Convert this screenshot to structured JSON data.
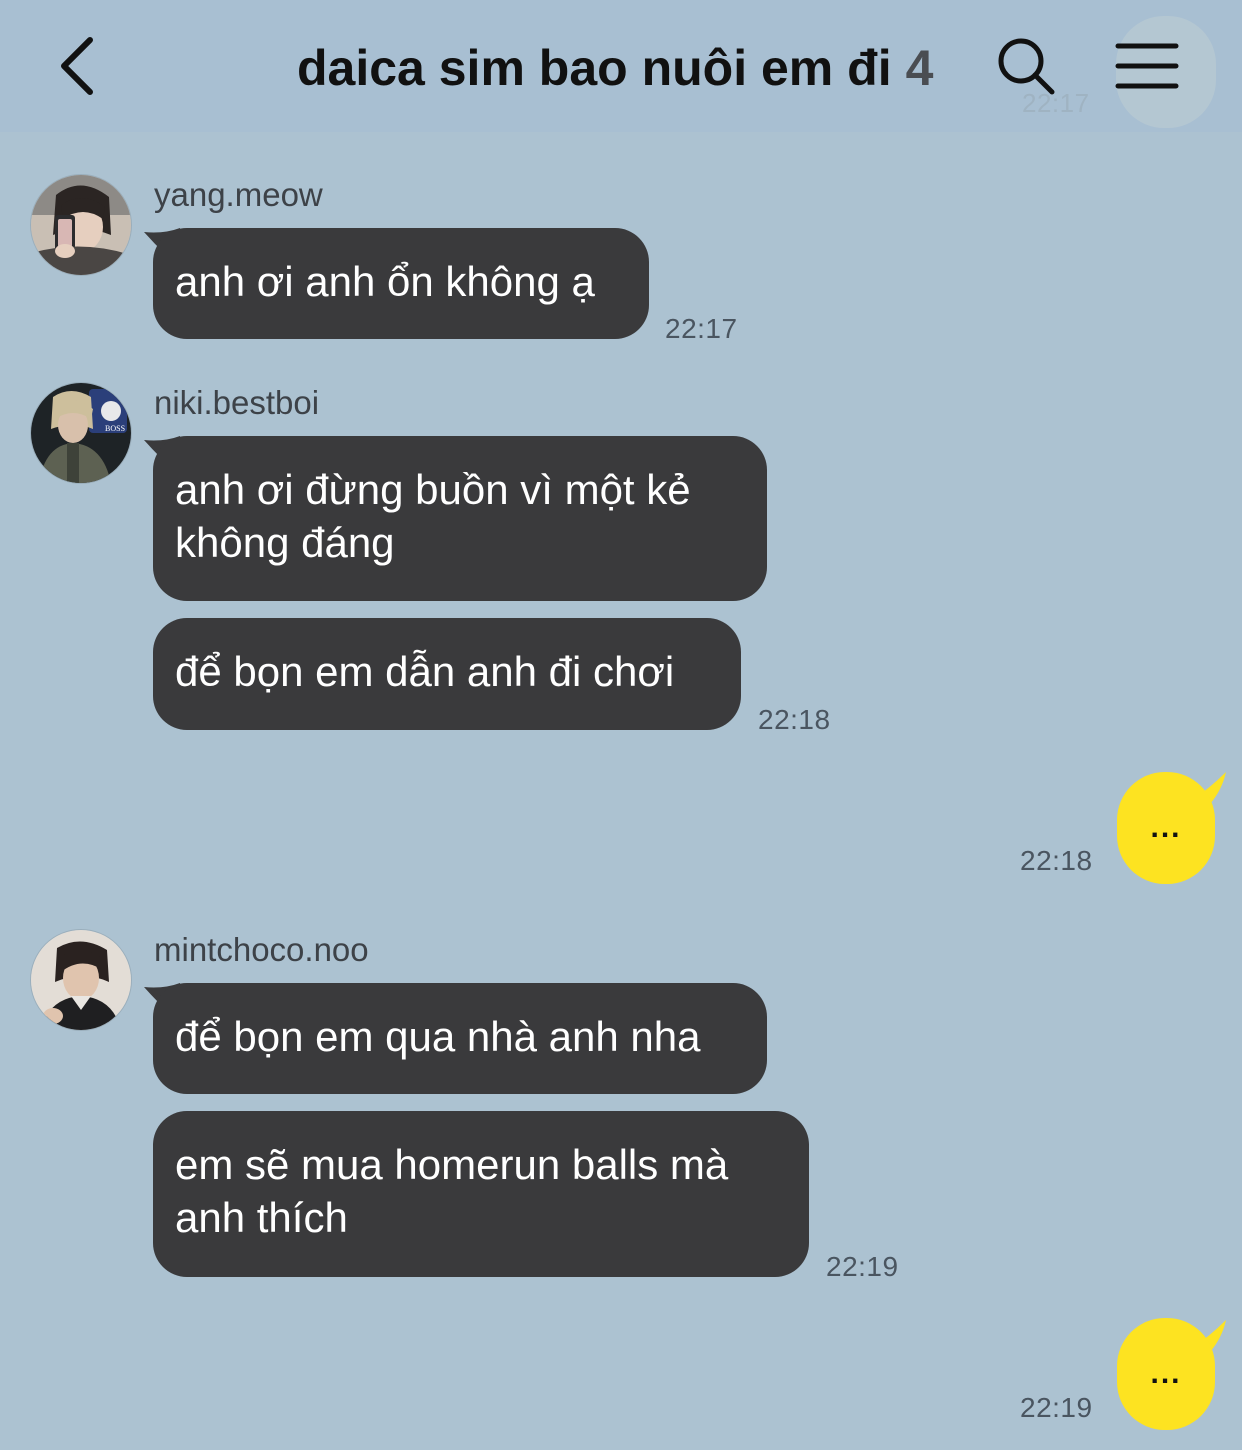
{
  "header": {
    "title": "daica sim bao nuôi em đi",
    "member_count": "4",
    "ghost_time": "22:17"
  },
  "messages": {
    "m1": {
      "sender": "yang.meow",
      "lines": [
        "anh ơi anh ổn không ạ"
      ],
      "time": "22:17"
    },
    "m2": {
      "sender": "niki.bestboi",
      "bubble1_lines": [
        "anh ơi đừng buồn vì một kẻ",
        "không đáng"
      ],
      "bubble2_lines": [
        "để bọn em dẫn anh đi chơi"
      ],
      "time": "22:18"
    },
    "out1": {
      "text": "...",
      "time": "22:18"
    },
    "m3": {
      "sender": "mintchoco.noo",
      "bubble1_lines": [
        "để bọn em qua nhà anh nha"
      ],
      "bubble2_lines": [
        "em sẽ mua homerun balls mà",
        "anh thích"
      ],
      "time": "22:19"
    },
    "out2": {
      "text": "...",
      "time": "22:19"
    }
  },
  "colors": {
    "background": "#acc2d1",
    "header": "#a8bfd2",
    "incoming_bubble": "#3a3a3c",
    "outgoing_bubble": "#fde321"
  }
}
